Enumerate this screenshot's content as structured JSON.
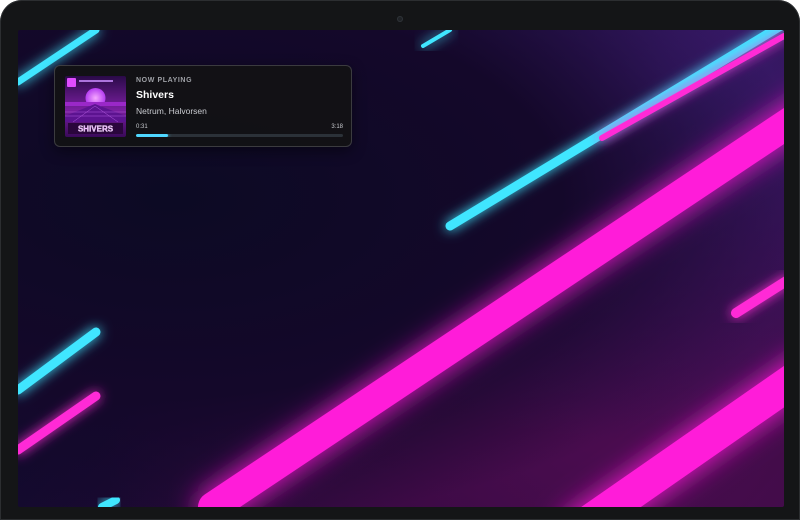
{
  "now_playing": {
    "header": "NOW PLAYING",
    "title": "Shivers",
    "artist": "Netrum, Halvorsen",
    "elapsed": "0:31",
    "duration": "3:18",
    "progress": 0.157,
    "album_art": {
      "title_text": "SHIVERS"
    }
  },
  "colors": {
    "accent": "#4fd7ff",
    "neon_pink": "#ff2bd6",
    "neon_cyan": "#3fe6ff"
  }
}
